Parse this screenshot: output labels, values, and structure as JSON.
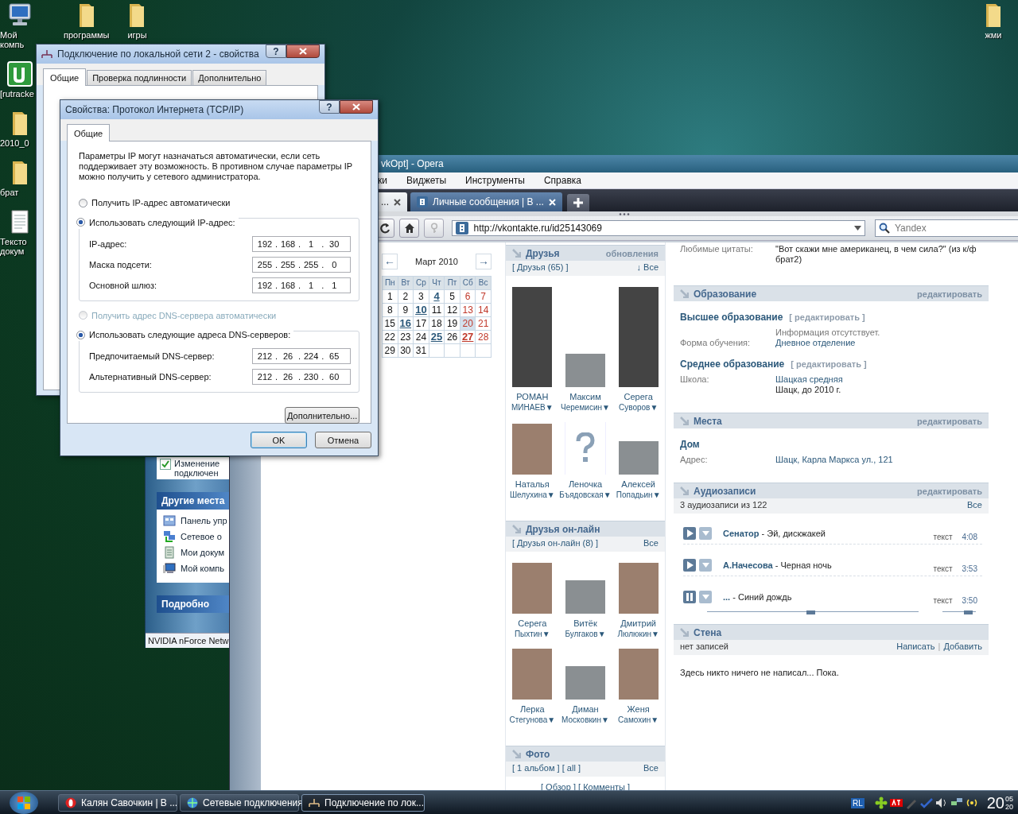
{
  "desktop": {
    "left_icons": [
      {
        "label": "Мой компь",
        "kind": "computer"
      },
      {
        "label": "[rutracke",
        "kind": "app"
      },
      {
        "label": "2010_0",
        "kind": "folder"
      },
      {
        "label": "брат",
        "kind": "folder"
      },
      {
        "label": "Тексто докум",
        "kind": "document"
      }
    ],
    "top_icons": [
      {
        "label": "программы",
        "kind": "folder"
      },
      {
        "label": "игры",
        "kind": "folder"
      }
    ],
    "right_icons": [
      {
        "label": "жми",
        "kind": "folder"
      }
    ]
  },
  "explorer": {
    "task": "Изменение подключен",
    "panels": [
      {
        "title": "Другие места",
        "items": [
          {
            "label": "Панель упр",
            "kind": "control_panel"
          },
          {
            "label": "Сетевое о",
            "kind": "network"
          },
          {
            "label": "Мои докум",
            "kind": "documents"
          },
          {
            "label": "Мой компь",
            "kind": "computer"
          }
        ]
      },
      {
        "title": "Подробно"
      }
    ],
    "status": "NVIDIA nForce Netw"
  },
  "browser": {
    "title": "vkOpt] - Opera",
    "menu": [
      "ки",
      "Виджеты",
      "Инструменты",
      "Справка"
    ],
    "tabs": [
      {
        "label": "...",
        "selected": true
      },
      {
        "label": "Личные сообщения | В ...",
        "selected": false
      }
    ],
    "address": "http://vkontakte.ru/id25143069",
    "search_placeholder": "Yandex",
    "calendar": {
      "prev": "←",
      "next": "→",
      "month": "Март 2010",
      "weekdays": [
        "Пн",
        "Вт",
        "Ср",
        "Чт",
        "Пт",
        "Сб",
        "Вс"
      ],
      "days": [
        {
          "d": "1",
          "event": false,
          "today": false
        },
        {
          "d": "2",
          "event": false,
          "today": false
        },
        {
          "d": "3",
          "event": false,
          "today": false
        },
        {
          "d": "4",
          "event": true,
          "today": false
        },
        {
          "d": "5",
          "event": false,
          "today": false
        },
        {
          "d": "6",
          "event": false,
          "today": false
        },
        {
          "d": "7",
          "event": false,
          "today": false
        },
        {
          "d": "8",
          "event": false,
          "today": false
        },
        {
          "d": "9",
          "event": false,
          "today": false
        },
        {
          "d": "10",
          "event": true,
          "today": false
        },
        {
          "d": "11",
          "event": false,
          "today": false
        },
        {
          "d": "12",
          "event": false,
          "today": false
        },
        {
          "d": "13",
          "event": false,
          "today": false
        },
        {
          "d": "14",
          "event": false,
          "today": false
        },
        {
          "d": "15",
          "event": false,
          "today": false
        },
        {
          "d": "16",
          "event": true,
          "today": false
        },
        {
          "d": "17",
          "event": false,
          "today": false
        },
        {
          "d": "18",
          "event": false,
          "today": false
        },
        {
          "d": "19",
          "event": false,
          "today": false
        },
        {
          "d": "20",
          "event": false,
          "today": true
        },
        {
          "d": "21",
          "event": false,
          "today": false
        },
        {
          "d": "22",
          "event": false,
          "today": false
        },
        {
          "d": "23",
          "event": false,
          "today": false
        },
        {
          "d": "24",
          "event": false,
          "today": false
        },
        {
          "d": "25",
          "event": true,
          "today": false
        },
        {
          "d": "26",
          "event": false,
          "today": false
        },
        {
          "d": "27",
          "event": true,
          "today": false
        },
        {
          "d": "28",
          "event": false,
          "today": false
        },
        {
          "d": "29",
          "event": false,
          "today": false
        },
        {
          "d": "30",
          "event": false,
          "today": false
        },
        {
          "d": "31",
          "event": false,
          "today": false
        }
      ]
    },
    "friend_blocks": [
      {
        "title": "Друзья",
        "action": "обновления",
        "link": "[ Друзья (65) ]",
        "all": "↓ Все",
        "friends": [
          {
            "first": "РОМАН",
            "last": "МИНАЕВ▼",
            "kind": "tall"
          },
          {
            "first": "Максим",
            "last": "Черемисин▼",
            "kind": "small"
          },
          {
            "first": "Серега",
            "last": "Суворов▼",
            "kind": "tall"
          },
          {
            "first": "Наталья",
            "last": "Шелухина▼",
            "kind": "square"
          },
          {
            "first": "Леночка",
            "last": "Бъядовская▼",
            "kind": "none"
          },
          {
            "first": "Алексей",
            "last": "Попадьин▼",
            "kind": "small"
          }
        ]
      },
      {
        "title": "Друзья он-лайн",
        "link": "[ Друзья он-лайн (8) ]",
        "all": "Все",
        "friends": [
          {
            "first": "Серега",
            "last": "Пыхтин▼",
            "kind": "square"
          },
          {
            "first": "Витёк",
            "last": "Булгаков▼",
            "kind": "small"
          },
          {
            "first": "Дмитрий",
            "last": "Люлюкин▼",
            "kind": "square"
          },
          {
            "first": "Лерка",
            "last": "Стегунова▼",
            "kind": "square"
          },
          {
            "first": "Диман",
            "last": "Московкин▼",
            "kind": "small"
          },
          {
            "first": "Женя",
            "last": "Самохин▼",
            "kind": "square"
          }
        ]
      }
    ],
    "photos": {
      "title": "Фото",
      "links": "[ 1 альбом ] [ all ]",
      "all": "Все",
      "footer": "[ Обзор ] [ Комменты ]"
    },
    "quote": {
      "label": "Любимые цитаты:",
      "value": "\"Вот скажи мне американец, в чем сила?\" (из к/ф брат2)"
    },
    "info_sections": [
      {
        "title": "Образование",
        "edit": "редактировать",
        "groups": [
          {
            "title": "Высшее образование",
            "edit": "[ редактировать ]",
            "rows": [
              {
                "value": "Информация отсутствует.",
                "kind": "muted"
              },
              {
                "label": "Форма обучения:",
                "value": "Дневное отделение",
                "kind": "link"
              }
            ]
          },
          {
            "title": "Среднее образование",
            "edit": "[ редактировать ]",
            "rows": [
              {
                "label": "Школа:",
                "value": "Шацкая средняя",
                "kind": "link"
              },
              {
                "value": "Шацк, до 2010 г.",
                "kind": "plain"
              }
            ]
          }
        ]
      },
      {
        "title": "Места",
        "edit": "редактировать",
        "groups": [
          {
            "title": "Дом",
            "rows": [
              {
                "label": "Адрес:",
                "value": "Шацк, Карла Маркса ул., 121",
                "kind": "link"
              }
            ]
          }
        ]
      }
    ],
    "audio": {
      "title": "Аудиозаписи",
      "edit": "редактировать",
      "count": "3 аудиозаписи из 122",
      "all": "Все",
      "tracks": [
        {
          "title": "**Сенатор** - Эй, дискжакей",
          "lyrics": "текст",
          "duration": "4:08",
          "playing": false
        },
        {
          "title": "**А.Начесова** - Черная ночь",
          "lyrics": "текст",
          "duration": "3:53",
          "playing": false
        },
        {
          "title": "**...** - Синий дождь",
          "lyrics": "текст",
          "duration": "3:50",
          "playing": true
        }
      ],
      "progress": {
        "level": 0.49
      },
      "volume": {
        "level": 0.75
      }
    },
    "wall": {
      "title": "Стена",
      "count": "нет записей",
      "actions": [
        "Написать",
        "Добавить"
      ],
      "separator": "|",
      "message": "Здесь никто ничего не написал... Пока."
    }
  },
  "properties_dialog": {
    "title": "Подключение по локальной сети 2 - свойства",
    "help": "?",
    "tabs": [
      {
        "label": "Общие",
        "selected": true
      },
      {
        "label": "Проверка подлинности",
        "selected": false
      },
      {
        "label": "Дополнительно",
        "selected": false
      }
    ]
  },
  "tcpip_dialog": {
    "title": "Свойства: Протокол Интернета (TCP/IP)",
    "help": "?",
    "tabs": [
      {
        "label": "Общие",
        "selected": true
      }
    ],
    "intro": "Параметры IP могут назначаться автоматически, если сеть поддерживает эту возможность. В противном случае параметры IP можно получить у сетевого администратора.",
    "separator": ".",
    "ip_mode": [
      {
        "label": "Получить IP-адрес автоматически",
        "selected": false,
        "disabled": false
      },
      {
        "label": "Использовать следующий IP-адрес:",
        "selected": true,
        "disabled": false
      }
    ],
    "ip_fields": [
      {
        "label": "IP-адрес:",
        "octets": [
          "192",
          "168",
          "1",
          "30"
        ]
      },
      {
        "label": "Маска подсети:",
        "octets": [
          "255",
          "255",
          "255",
          "0"
        ]
      },
      {
        "label": "Основной шлюз:",
        "octets": [
          "192",
          "168",
          "1",
          "1"
        ]
      }
    ],
    "dns_mode": [
      {
        "label": "Получить адрес DNS-сервера автоматически",
        "selected": false,
        "disabled": true
      },
      {
        "label": "Использовать следующие адреса DNS-серверов:",
        "selected": true,
        "disabled": false
      }
    ],
    "dns_fields": [
      {
        "label": "Предпочитаемый DNS-сервер:",
        "octets": [
          "212",
          "26",
          "224",
          "65"
        ]
      },
      {
        "label": "Альтернативный DNS-сервер:",
        "octets": [
          "212",
          "26",
          "230",
          "60"
        ]
      }
    ],
    "advanced_button": "Дополнительно...",
    "ok_button": "OK",
    "cancel_button": "Отмена"
  },
  "taskbar": {
    "tasks": [
      {
        "label": "Калян Савочкин | В ...",
        "kind": "browser",
        "selected": false
      },
      {
        "label": "Сетевые подключения",
        "kind": "network",
        "selected": false
      },
      {
        "label": "Подключение по лок...",
        "kind": "connection",
        "selected": true
      }
    ],
    "language": "RL",
    "clock": {
      "hours": "20",
      "minutes": "05",
      "seconds": "20"
    }
  }
}
